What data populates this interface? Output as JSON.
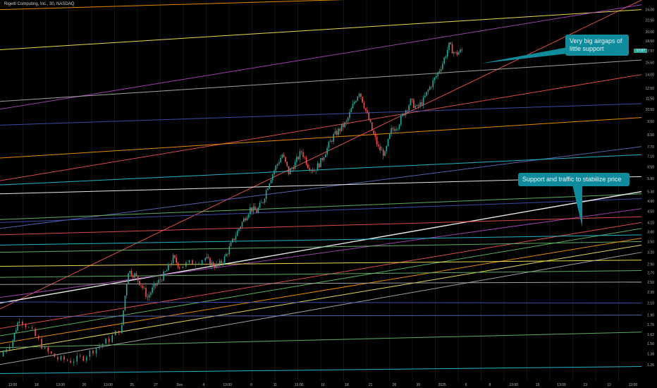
{
  "header": {
    "title": "Rigetti Computing, Inc., 30, NASDAQ"
  },
  "colors": {
    "background": "#000000",
    "up": "#26a69a",
    "down": "#ef5350",
    "callout": "#0f8b9b"
  },
  "chart_data": {
    "type": "candlestick",
    "ylim": [
      1.1,
      26
    ],
    "log_scale": true,
    "y_ticks": [
      "26.00",
      "24.00",
      "22.00",
      "20.00",
      "18.50",
      "17.07",
      "15.50",
      "14.00",
      "12.50",
      "11.50",
      "10.50",
      "9.50",
      "8.50",
      "7.70",
      "7.10",
      "6.50",
      "5.90",
      "5.30",
      "4.90",
      "4.50",
      "4.10",
      "3.80",
      "3.50",
      "3.20",
      "2.90",
      "2.70",
      "2.50",
      "2.30",
      "2.10",
      "1.90",
      "1.76",
      "1.62",
      "1.50",
      "1.38",
      "1.26"
    ],
    "x_ticks": [
      "13:00",
      "18",
      "13:00",
      "20",
      "13:00",
      "25",
      "27",
      "Dec",
      "4",
      "13:00",
      "9",
      "11",
      "13:00",
      "16",
      "18",
      "21",
      "26",
      "30",
      "2025",
      "6",
      "8",
      "13:00",
      "15",
      "13:00",
      "13",
      "12",
      "13:00"
    ],
    "last_price": "17.07",
    "annotations": [
      "Very big airgaps of little support",
      "Support and traffic to stabilize price"
    ],
    "trendlines": [
      {
        "color": "#ef5350",
        "p1": [
          0,
          2.0
        ],
        "p2": [
          1,
          26
        ]
      },
      {
        "color": "#ff9800",
        "p1": [
          0,
          24
        ],
        "p2": [
          1,
          28
        ]
      },
      {
        "color": "#ffee58",
        "p1": [
          0,
          17.2
        ],
        "p2": [
          1,
          24.0
        ]
      },
      {
        "color": "#ab47bc",
        "p1": [
          0,
          10.5
        ],
        "p2": [
          1,
          25
        ]
      },
      {
        "color": "#b0b0b0",
        "p1": [
          0,
          11.2
        ],
        "p2": [
          1,
          15.8
        ]
      },
      {
        "color": "#ef5350",
        "p1": [
          0,
          5.8
        ],
        "p2": [
          1,
          14.0
        ]
      },
      {
        "color": "#3f51b5",
        "p1": [
          0,
          9.2
        ],
        "p2": [
          1,
          11.0
        ]
      },
      {
        "color": "#ff9800",
        "p1": [
          0,
          7.0
        ],
        "p2": [
          1,
          9.8
        ]
      },
      {
        "color": "#5c6bc0",
        "p1": [
          0,
          3.9
        ],
        "p2": [
          1,
          7.7
        ]
      },
      {
        "color": "#26c6da",
        "p1": [
          0,
          5.6
        ],
        "p2": [
          1,
          7.2
        ]
      },
      {
        "color": "#ffffff",
        "p1": [
          0,
          5.2
        ],
        "p2": [
          1,
          6.0
        ]
      },
      {
        "color": "#66bb6a",
        "p1": [
          0,
          4.2
        ],
        "p2": [
          1,
          5.2
        ]
      },
      {
        "color": "#3f51b5",
        "p1": [
          0,
          4.1
        ],
        "p2": [
          1,
          5.0
        ]
      },
      {
        "color": "#ffffff",
        "p1": [
          0,
          2.1
        ],
        "p2": [
          1,
          5.3
        ]
      },
      {
        "color": "#ab47bc",
        "p1": [
          0,
          2.2
        ],
        "p2": [
          1,
          4.6
        ]
      },
      {
        "color": "#ef5350",
        "p1": [
          0,
          3.7
        ],
        "p2": [
          1,
          4.3
        ]
      },
      {
        "color": "#ef5350",
        "p1": [
          0,
          1.7
        ],
        "p2": [
          1,
          4.1
        ]
      },
      {
        "color": "#66bb6a",
        "p1": [
          0,
          1.6
        ],
        "p2": [
          1,
          3.9
        ]
      },
      {
        "color": "#26c6da",
        "p1": [
          0,
          3.4
        ],
        "p2": [
          1,
          3.7
        ]
      },
      {
        "color": "#66bb6a",
        "p1": [
          0,
          3.2
        ],
        "p2": [
          1,
          3.5
        ]
      },
      {
        "color": "#ff9800",
        "p1": [
          0,
          1.5
        ],
        "p2": [
          1,
          3.6
        ]
      },
      {
        "color": "#ffee58",
        "p1": [
          0,
          1.4
        ],
        "p2": [
          1,
          3.4
        ]
      },
      {
        "color": "#ffee58",
        "p1": [
          0,
          2.85
        ],
        "p2": [
          1,
          3.0
        ]
      },
      {
        "color": "#b0b0b0",
        "p1": [
          0,
          1.26
        ],
        "p2": [
          1,
          3.2
        ]
      },
      {
        "color": "#66bb6a",
        "p1": [
          0,
          2.6
        ],
        "p2": [
          1,
          2.75
        ]
      },
      {
        "color": "#b0b0b0",
        "p1": [
          0,
          2.45
        ],
        "p2": [
          1,
          2.5
        ]
      },
      {
        "color": "#3f51b5",
        "p1": [
          0,
          2.12
        ],
        "p2": [
          1,
          2.1
        ]
      },
      {
        "color": "#5c6bc0",
        "p1": [
          0,
          1.88
        ],
        "p2": [
          1,
          1.9
        ]
      },
      {
        "color": "#66bb6a",
        "p1": [
          0,
          1.45
        ],
        "p2": [
          1,
          1.65
        ]
      },
      {
        "color": "#26c6da",
        "p1": [
          0,
          1.17
        ],
        "p2": [
          1,
          1.24
        ]
      }
    ],
    "price_path": [
      [
        0.0,
        1.35
      ],
      [
        0.02,
        1.55
      ],
      [
        0.03,
        1.85
      ],
      [
        0.05,
        1.65
      ],
      [
        0.07,
        1.42
      ],
      [
        0.09,
        1.32
      ],
      [
        0.11,
        1.3
      ],
      [
        0.13,
        1.34
      ],
      [
        0.15,
        1.45
      ],
      [
        0.17,
        1.55
      ],
      [
        0.19,
        1.72
      ],
      [
        0.2,
        2.75
      ],
      [
        0.21,
        2.65
      ],
      [
        0.22,
        2.45
      ],
      [
        0.23,
        2.2
      ],
      [
        0.24,
        2.4
      ],
      [
        0.25,
        2.55
      ],
      [
        0.26,
        2.75
      ],
      [
        0.27,
        3.05
      ],
      [
        0.28,
        2.85
      ],
      [
        0.3,
        2.95
      ],
      [
        0.32,
        3.05
      ],
      [
        0.33,
        2.9
      ],
      [
        0.34,
        2.85
      ],
      [
        0.35,
        3.05
      ],
      [
        0.36,
        3.4
      ],
      [
        0.37,
        3.8
      ],
      [
        0.38,
        4.2
      ],
      [
        0.39,
        4.6
      ],
      [
        0.4,
        4.5
      ],
      [
        0.41,
        4.9
      ],
      [
        0.42,
        5.8
      ],
      [
        0.43,
        6.5
      ],
      [
        0.44,
        7.2
      ],
      [
        0.45,
        6.2
      ],
      [
        0.46,
        6.7
      ],
      [
        0.47,
        7.4
      ],
      [
        0.48,
        6.6
      ],
      [
        0.49,
        6.3
      ],
      [
        0.5,
        6.8
      ],
      [
        0.51,
        7.6
      ],
      [
        0.52,
        8.4
      ],
      [
        0.53,
        8.9
      ],
      [
        0.54,
        9.4
      ],
      [
        0.55,
        10.8
      ],
      [
        0.56,
        12.2
      ],
      [
        0.57,
        10.4
      ],
      [
        0.58,
        8.8
      ],
      [
        0.59,
        7.6
      ],
      [
        0.6,
        7.2
      ],
      [
        0.61,
        8.8
      ],
      [
        0.62,
        9.2
      ],
      [
        0.63,
        10.2
      ],
      [
        0.64,
        11.2
      ],
      [
        0.65,
        10.6
      ],
      [
        0.66,
        11.3
      ],
      [
        0.67,
        12.6
      ],
      [
        0.68,
        13.8
      ],
      [
        0.69,
        15.4
      ],
      [
        0.7,
        17.8
      ],
      [
        0.71,
        16.6
      ],
      [
        0.72,
        17.07
      ]
    ]
  }
}
